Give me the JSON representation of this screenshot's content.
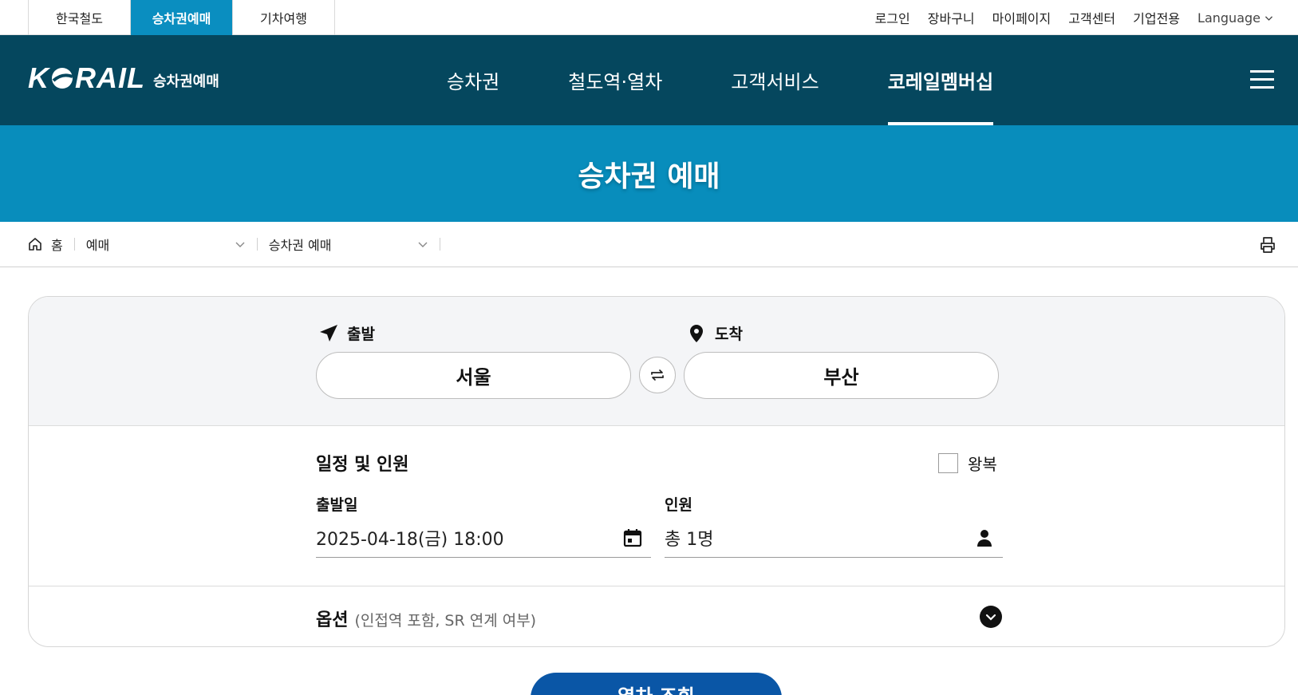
{
  "site_tabs": [
    "한국철도",
    "승차권예매",
    "기차여행"
  ],
  "util_links": {
    "login": "로그인",
    "cart": "장바구니",
    "mypage": "마이페이지",
    "customer_center": "고객센터",
    "corporate": "기업전용",
    "language": "Language"
  },
  "logo": {
    "wordmark_left": "K",
    "wordmark_right": "RAIL",
    "subtitle": "승차권예매"
  },
  "nav": {
    "items": [
      "승차권",
      "철도역·열차",
      "고객서비스",
      "코레일멤버십"
    ],
    "active_index": 3
  },
  "banner": {
    "title": "승차권 예매"
  },
  "breadcrumb": {
    "home": "홈",
    "level1": "예매",
    "level2": "승차권 예매"
  },
  "search": {
    "departure_label": "출발",
    "departure_value": "서울",
    "arrival_label": "도착",
    "arrival_value": "부산",
    "schedule_title": "일정 및 인원",
    "roundtrip_label": "왕복",
    "roundtrip_checked": false,
    "date_label": "출발일",
    "date_value": "2025-04-18(금) 18:00",
    "passenger_label": "인원",
    "passenger_value": "총 1명",
    "options_title": "옵션",
    "options_desc": "(인접역 포함, SR 연계 여부)",
    "submit_label": "열차 조회"
  },
  "colors": {
    "nav_bg": "#05475e",
    "banner_bg": "#088dbc",
    "active_tab": "#0a8ec0",
    "button": "#0a56a6"
  },
  "icons": [
    "home-icon",
    "chevron-down-icon",
    "print-icon",
    "departure-arrow-icon",
    "location-pin-icon",
    "swap-icon",
    "calendar-icon",
    "person-icon",
    "menu-icon"
  ]
}
